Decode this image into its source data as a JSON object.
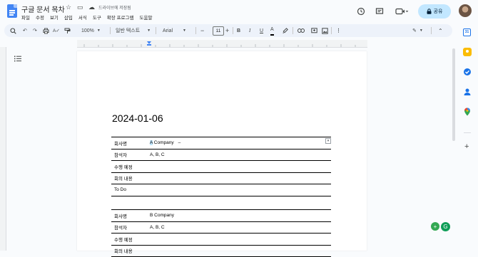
{
  "header": {
    "title": "구글 문서 목차",
    "saved_status": "드라이브에 저장됨",
    "menus": [
      "파일",
      "수정",
      "보기",
      "삽입",
      "서식",
      "도구",
      "확장 프로그램",
      "도움말"
    ],
    "share_label": "공유"
  },
  "toolbar": {
    "zoom": "100%",
    "style": "일반 텍스트",
    "font": "Arial",
    "font_size": "11"
  },
  "document": {
    "date": "2024-01-06",
    "tables": [
      {
        "rows": [
          {
            "label": "회사명",
            "value": "A Company"
          },
          {
            "label": "참석자",
            "value": "A, B, C"
          },
          {
            "label": "수행 예정",
            "value": ""
          },
          {
            "label": "회의 내용",
            "value": ""
          },
          {
            "label": "To Do",
            "value": ""
          }
        ]
      },
      {
        "rows": [
          {
            "label": "회사명",
            "value": "B Company"
          },
          {
            "label": "참석자",
            "value": "A, B, C"
          },
          {
            "label": "수행 예정",
            "value": ""
          },
          {
            "label": "회의 내용",
            "value": ""
          }
        ]
      }
    ]
  },
  "colors": {
    "accent": "#4285f4",
    "share_bg": "#c2e7ff",
    "toolbar_bg": "#edf2fa"
  },
  "icons": [
    "docs-logo-icon",
    "star-icon",
    "folder-icon",
    "cloud-icon",
    "history-icon",
    "comment-icon",
    "meet-icon",
    "lock-icon",
    "undo-icon",
    "redo-icon",
    "print-icon",
    "spellcheck-icon",
    "paint-format-icon",
    "outline-icon",
    "calendar-icon",
    "keep-icon",
    "tasks-icon",
    "contacts-icon",
    "maps-icon"
  ]
}
